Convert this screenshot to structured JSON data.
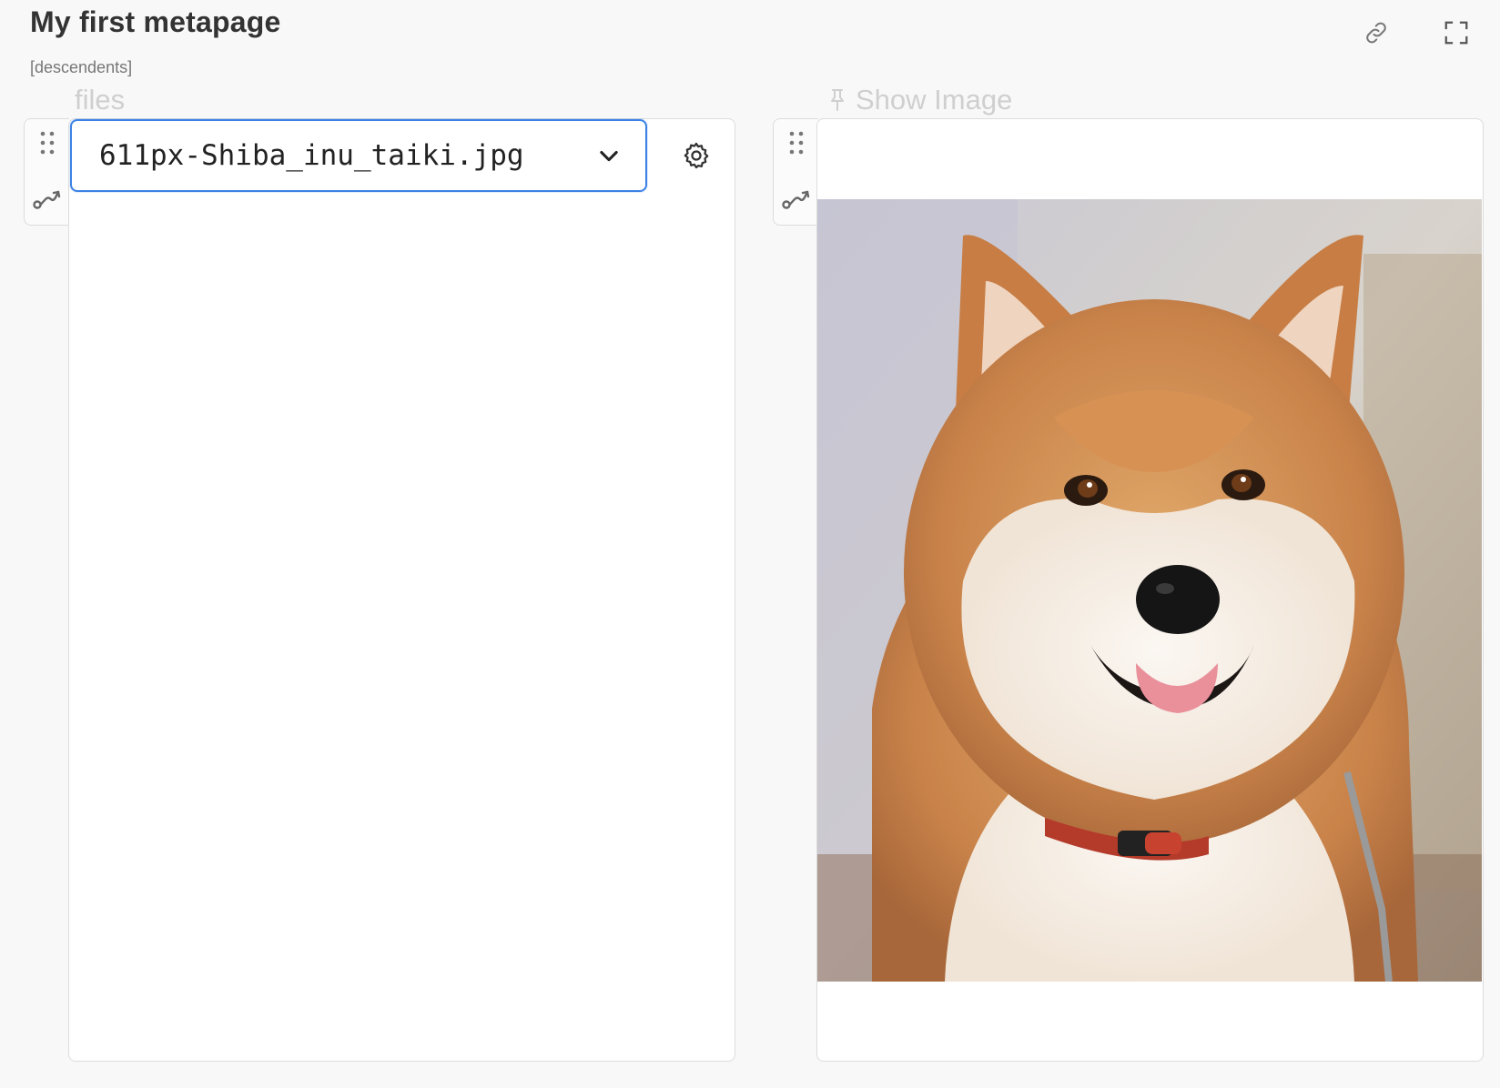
{
  "header": {
    "title": "My first metapage",
    "subtitle": "[descendents]",
    "link_icon": "link-icon",
    "fullscreen_icon": "fullscreen-icon"
  },
  "panels": [
    {
      "label": "files",
      "drag_icon": "drag-handle-icon",
      "connect_icon": "connection-icon",
      "select": {
        "value": "611px-Shiba_inu_taiki.jpg",
        "chevron_icon": "chevron-down-icon"
      },
      "settings_icon": "gear-icon"
    },
    {
      "label": "Show Image",
      "pin_icon": "pin-icon",
      "drag_icon": "drag-handle-icon",
      "connect_icon": "connection-icon",
      "image_subject": "shiba-inu-dog-photo"
    }
  ],
  "colors": {
    "accent": "#3b82e6",
    "background": "#f8f8f8",
    "panel_border": "#dcdcdc",
    "label_muted": "#cfcfcf"
  }
}
